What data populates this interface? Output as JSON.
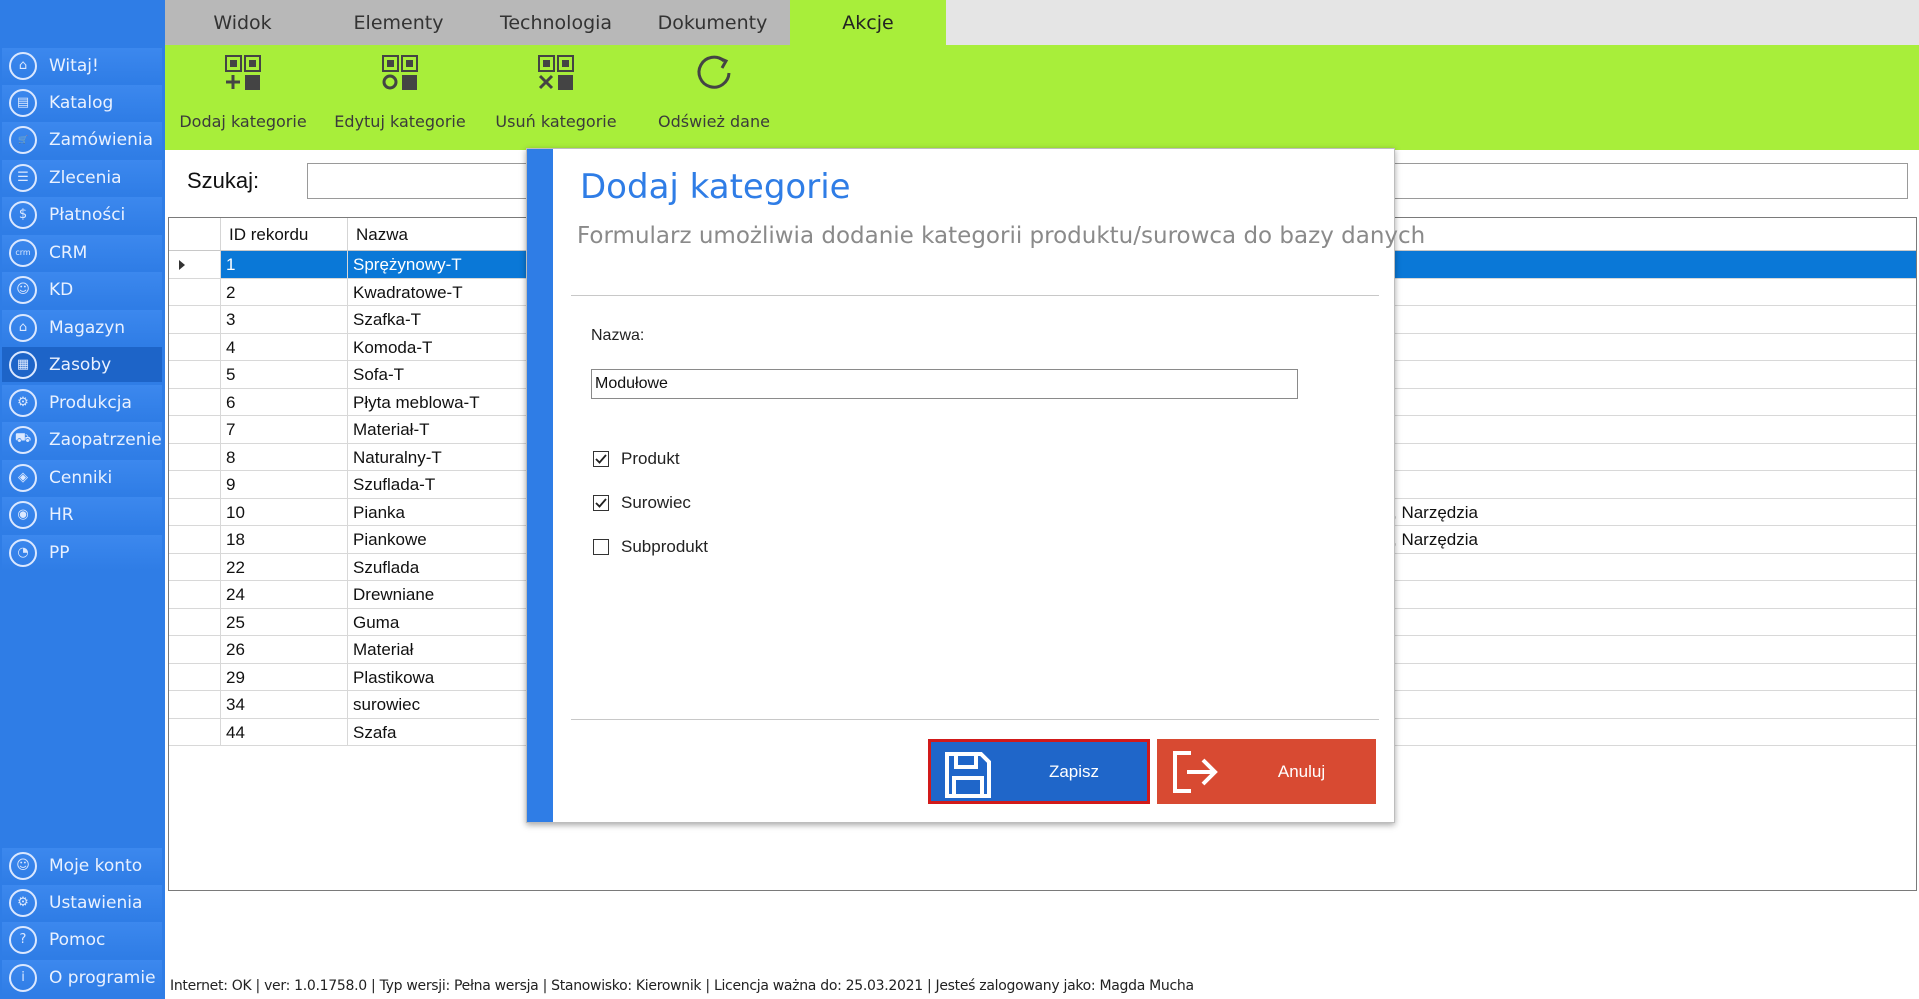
{
  "sidebar": {
    "items": [
      {
        "label": "Witaj!",
        "icon": "home-icon",
        "glyph": "⌂"
      },
      {
        "label": "Katalog",
        "icon": "catalog-icon",
        "glyph": "▤"
      },
      {
        "label": "Zamówienia",
        "icon": "cart-icon",
        "glyph": "🛒"
      },
      {
        "label": "Zlecenia",
        "icon": "list-icon",
        "glyph": "☰"
      },
      {
        "label": "Płatności",
        "icon": "dollar-icon",
        "glyph": "$"
      },
      {
        "label": "CRM",
        "icon": "crm-icon",
        "glyph": "crm"
      },
      {
        "label": "KD",
        "icon": "person-icon",
        "glyph": "☺"
      },
      {
        "label": "Magazyn",
        "icon": "warehouse-icon",
        "glyph": "⌂"
      },
      {
        "label": "Zasoby",
        "icon": "resources-icon",
        "glyph": "▦"
      },
      {
        "label": "Produkcja",
        "icon": "production-icon",
        "glyph": "⚙"
      },
      {
        "label": "Zaopatrzenie",
        "icon": "truck-icon",
        "glyph": "⛟"
      },
      {
        "label": "Cenniki",
        "icon": "tag-icon",
        "glyph": "◈"
      },
      {
        "label": "HR",
        "icon": "hr-icon",
        "glyph": "◉"
      },
      {
        "label": "PP",
        "icon": "pp-icon",
        "glyph": "◔"
      }
    ],
    "bottom_items": [
      {
        "label": "Moje konto",
        "icon": "account-icon",
        "glyph": "☺"
      },
      {
        "label": "Ustawienia",
        "icon": "settings-icon",
        "glyph": "⚙"
      },
      {
        "label": "Pomoc",
        "icon": "help-icon",
        "glyph": "?"
      },
      {
        "label": "O programie",
        "icon": "info-icon",
        "glyph": "i"
      }
    ]
  },
  "tabs": [
    "Widok",
    "Elementy",
    "Technologia",
    "Dokumenty",
    "Akcje"
  ],
  "ribbon": {
    "add": "Dodaj kategorie",
    "edit": "Edytuj kategorie",
    "delete": "Usuń kategorie",
    "refresh": "Odśwież dane"
  },
  "search": {
    "label": "Szukaj:",
    "value": ""
  },
  "grid": {
    "columns": [
      "ID rekordu",
      "Nazwa"
    ],
    "rows": [
      {
        "id": "1",
        "name": "Sprężynowy-T",
        "extra": ""
      },
      {
        "id": "2",
        "name": "Kwadratowe-T",
        "extra": ""
      },
      {
        "id": "3",
        "name": "Szafka-T",
        "extra": ""
      },
      {
        "id": "4",
        "name": "Komoda-T",
        "extra": ""
      },
      {
        "id": "5",
        "name": "Sofa-T",
        "extra": ""
      },
      {
        "id": "6",
        "name": "Płyta meblowa-T",
        "extra": ""
      },
      {
        "id": "7",
        "name": "Materiał-T",
        "extra": ""
      },
      {
        "id": "8",
        "name": "Naturalny-T",
        "extra": ""
      },
      {
        "id": "9",
        "name": "Szuflada-T",
        "extra": ""
      },
      {
        "id": "10",
        "name": "Pianka",
        "extra": ", Narzędzia"
      },
      {
        "id": "18",
        "name": "Piankowe",
        "extra": ", Narzędzia"
      },
      {
        "id": "22",
        "name": "Szuflada",
        "extra": ""
      },
      {
        "id": "24",
        "name": "Drewniane",
        "extra": ""
      },
      {
        "id": "25",
        "name": "Guma",
        "extra": ""
      },
      {
        "id": "26",
        "name": "Materiał",
        "extra": ""
      },
      {
        "id": "29",
        "name": "Plastikowa",
        "extra": ""
      },
      {
        "id": "34",
        "name": "surowiec",
        "extra": ""
      },
      {
        "id": "44",
        "name": "Szafa",
        "extra": ""
      }
    ]
  },
  "modal": {
    "title": "Dodaj kategorie",
    "subtitle": "Formularz umożliwia dodanie kategorii produktu/surowca do bazy danych",
    "name_label": "Nazwa:",
    "name_value": "Modułowe",
    "checkboxes": [
      {
        "label": "Produkt",
        "checked": true
      },
      {
        "label": "Surowiec",
        "checked": true
      },
      {
        "label": "Subprodukt",
        "checked": false
      }
    ],
    "save": "Zapisz",
    "cancel": "Anuluj"
  },
  "status": "Internet: OK  |   ver: 1.0.1758.0   |   Typ wersji: Pełna wersja   |   Stanowisko: Kierownik   |   Licencja ważna do: 25.03.2021   |   Jesteś zalogowany jako: Magda Mucha",
  "colors": {
    "accent": "#2f7de6",
    "ribbon": "#a8ee3a",
    "selection": "#0a78d7",
    "save": "#1f66c9",
    "cancel": "#d84a32"
  }
}
